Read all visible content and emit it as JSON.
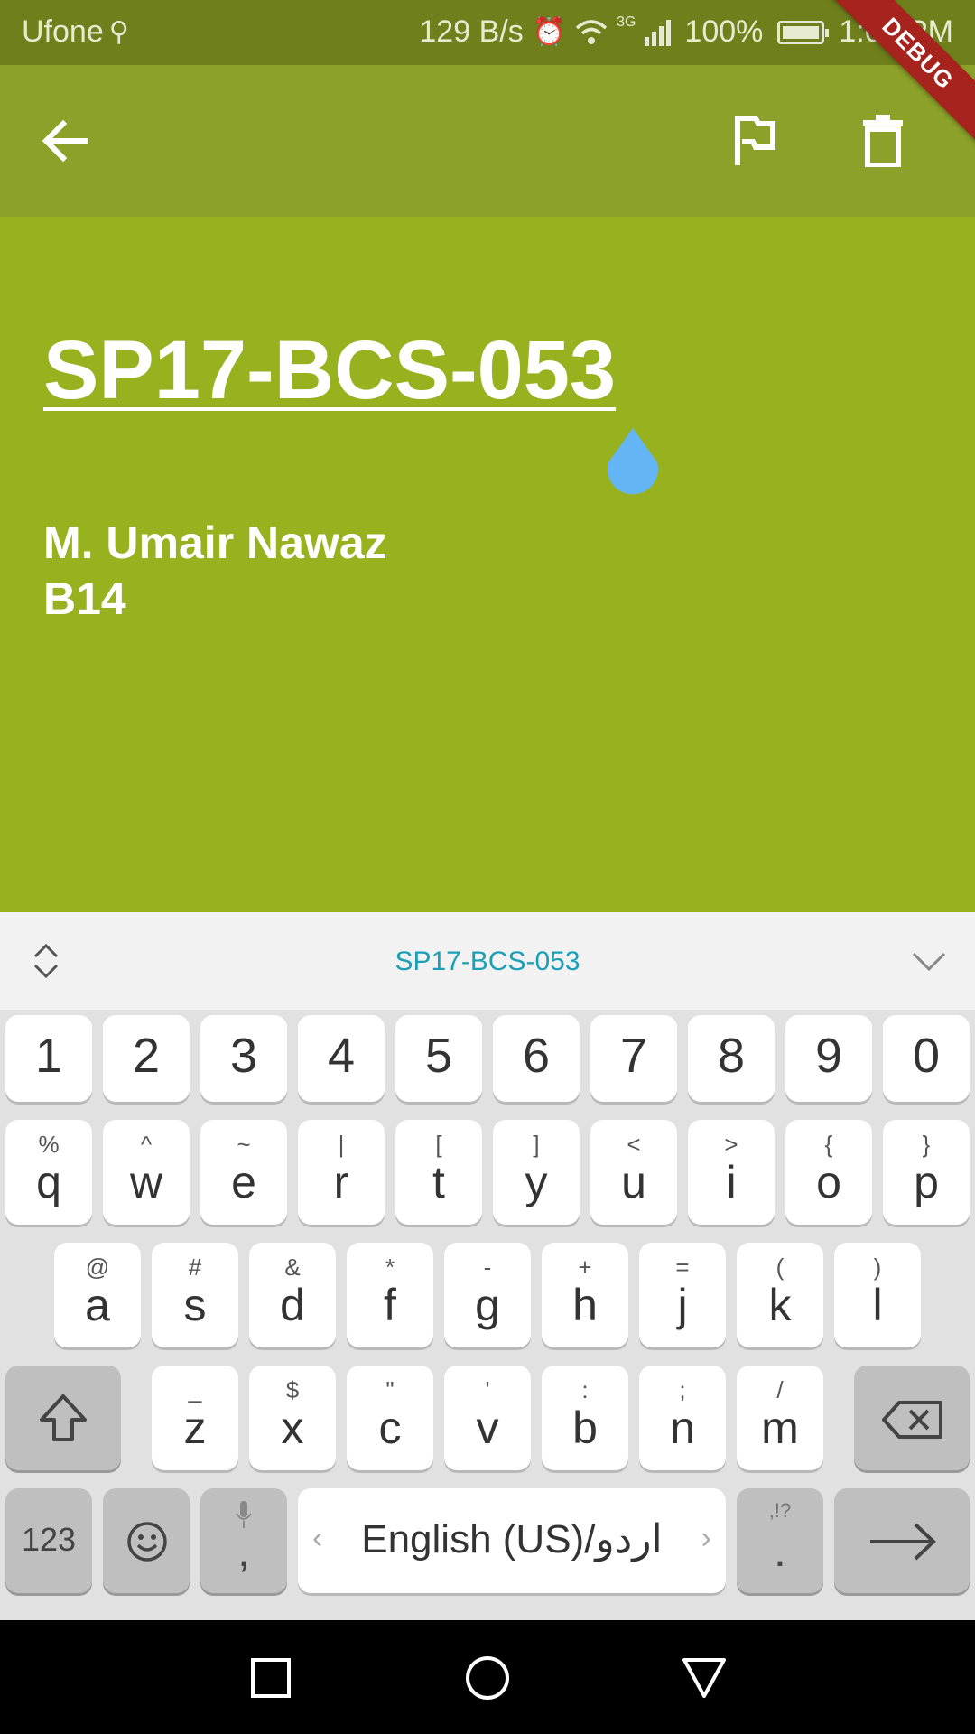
{
  "status": {
    "carrier": "Ufone",
    "net_speed": "129 B/s",
    "network": "3G",
    "battery": "100%",
    "time": "1:06 PM"
  },
  "debug_banner": "DEBUG",
  "appbar": {
    "back_icon": "arrow-left-icon",
    "flag_icon": "flag-icon",
    "delete_icon": "trash-icon"
  },
  "note": {
    "title": "SP17-BCS-053",
    "body_line1": "M. Umair Nawaz",
    "body_line2": "B14",
    "background": "#98b11f"
  },
  "keyboard": {
    "suggestion": "SP17-BCS-053",
    "number_row": [
      "1",
      "2",
      "3",
      "4",
      "5",
      "6",
      "7",
      "8",
      "9",
      "0"
    ],
    "row1": [
      [
        "q",
        "%"
      ],
      [
        "w",
        "^"
      ],
      [
        "e",
        "~"
      ],
      [
        "r",
        "|"
      ],
      [
        "t",
        "["
      ],
      [
        "y",
        "]"
      ],
      [
        "u",
        "<"
      ],
      [
        "i",
        ">"
      ],
      [
        "o",
        "{"
      ],
      [
        "p",
        "}"
      ]
    ],
    "row2": [
      [
        "a",
        "@"
      ],
      [
        "s",
        "#"
      ],
      [
        "d",
        "&"
      ],
      [
        "f",
        "*"
      ],
      [
        "g",
        "-"
      ],
      [
        "h",
        "+"
      ],
      [
        "j",
        "="
      ],
      [
        "k",
        "("
      ],
      [
        "l",
        ")"
      ]
    ],
    "row3": [
      [
        "z",
        "_"
      ],
      [
        "x",
        "$"
      ],
      [
        "c",
        "\""
      ],
      [
        "v",
        "'"
      ],
      [
        "b",
        ":"
      ],
      [
        "n",
        ";"
      ],
      [
        "m",
        "/"
      ]
    ],
    "symbols_label": "123",
    "comma": ",",
    "space_label": "English (US)/اردو",
    "period": ".",
    "period_sub": ",!?"
  }
}
